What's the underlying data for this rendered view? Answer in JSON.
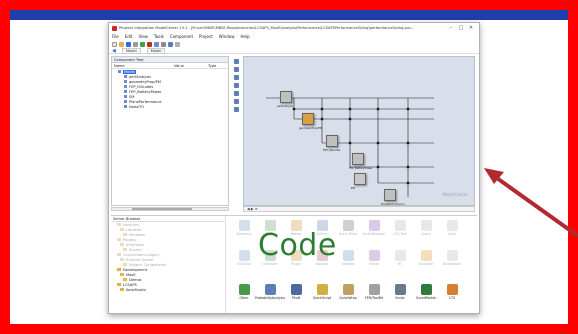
{
  "window": {
    "title": "Phoenix Integration ModelCenter 13.1 - [M:\\src\\MBSE\\MBSE-Repo\\branches\\LCSAPS_MaxE\\analysis\\Performance\\LCSAPSPerformanceSizing\\performanceSizing.pxc...",
    "min": "–",
    "max": "□",
    "close": "✕"
  },
  "menu": [
    "File",
    "Edit",
    "View",
    "Tools",
    "Component",
    "Project",
    "Window",
    "Help"
  ],
  "modebar": {
    "tab1": "Model",
    "tab2": "Model"
  },
  "tree": {
    "header": "Component Tree",
    "columns": [
      "Name",
      "Value",
      "Type"
    ],
    "items": [
      {
        "label": "Model",
        "selected": true,
        "child": false
      },
      {
        "label": "perfAnalysis",
        "selected": false,
        "child": true
      },
      {
        "label": "geometryProp/EM",
        "selected": false,
        "child": true
      },
      {
        "label": "FEP_ISGuides",
        "selected": false,
        "child": true
      },
      {
        "label": "FEP_BatteryPower",
        "selected": false,
        "child": true
      },
      {
        "label": "EM",
        "selected": false,
        "child": true
      },
      {
        "label": "PlanePerformance",
        "selected": false,
        "child": true
      },
      {
        "label": "NoiseTO",
        "selected": false,
        "child": true
      }
    ]
  },
  "canvas": {
    "nodes": [
      "perfAnalysis",
      "geometryProp/EM",
      "FEP_ISGuides",
      "FEP_BatteryPower",
      "EM",
      "PlanePerformance"
    ],
    "watermark": "ModelCenter"
  },
  "library": {
    "header": "Server Browser",
    "tree": [
      {
        "label": "Favorites",
        "dim": true
      },
      {
        "label": "Libraries",
        "dim": true
      },
      {
        "label": "Windows",
        "dim": true
      },
      {
        "label": "Plugins",
        "dim": true
      },
      {
        "label": "Interfaces",
        "dim": true
      },
      {
        "label": "Shared",
        "dim": true
      },
      {
        "label": "Connections plugins",
        "dim": true
      },
      {
        "label": "Analysis Server",
        "dim": true
      },
      {
        "label": "Project: Components",
        "dim": true
      },
      {
        "label": "Development",
        "dim": false
      },
      {
        "label": "MaxE",
        "dim": false
      },
      {
        "label": "Demos",
        "dim": false
      },
      {
        "label": "LCSAPS",
        "dim": false
      },
      {
        "label": "AeroStudio",
        "dim": false
      }
    ],
    "components_top": [
      {
        "label": "Assembly",
        "color": "#8aa4c8"
      },
      {
        "label": "Excel",
        "color": "#6fa86f"
      },
      {
        "label": "Matlab",
        "color": "#d6a14c"
      },
      {
        "label": "Python",
        "color": "#6f8fc0"
      },
      {
        "label": "Quick Wrap",
        "color": "#7a7a7a"
      },
      {
        "label": "ScriptWrapper",
        "color": "#a36ab8"
      },
      {
        "label": "CSV Tool",
        "color": "#c0c0c0"
      },
      {
        "label": "Query",
        "color": "#c0c0c0"
      },
      {
        "label": "Loop",
        "color": "#c0c0c0"
      }
    ],
    "components_mid": [
      {
        "label": "DOETool",
        "color": "#8aa4c8"
      },
      {
        "label": "Optimizer",
        "color": "#6fa86f"
      },
      {
        "label": "PlugIn",
        "color": "#d6a14c"
      },
      {
        "label": "NonAdd",
        "color": "#c07070"
      },
      {
        "label": "Variable",
        "color": "#7aa2c8"
      },
      {
        "label": "Monte",
        "color": "#a36ab8"
      },
      {
        "label": "MT",
        "color": "#c0c0c0"
      },
      {
        "label": "Visualizer",
        "color": "#e0a040"
      },
      {
        "label": "Distribution",
        "color": "#c0c0c0"
      }
    ],
    "components_bottom": [
      {
        "label": "Other",
        "color": "#4a9a4a"
      },
      {
        "label": "ProbabilityAnalysis",
        "color": "#5a7fb8"
      },
      {
        "label": "PhxB",
        "color": "#4a6aa0"
      },
      {
        "label": "QuickScript",
        "color": "#d0b040"
      },
      {
        "label": "QuickWrap",
        "color": "#c0a060"
      },
      {
        "label": "FEM/ToolBit",
        "color": "#a0a0a0"
      },
      {
        "label": "Script",
        "color": "#6a7a8a"
      },
      {
        "label": "ExcelWorkst",
        "color": "#2f7a3f"
      },
      {
        "label": "CTS",
        "color": "#d08030"
      }
    ]
  },
  "overlay_text": "Code",
  "colors": {
    "slide_border": "#ff0000",
    "slide_topbar": "#1f3fb0",
    "code_text": "#2e7d32",
    "arrow": "#b02a30"
  }
}
